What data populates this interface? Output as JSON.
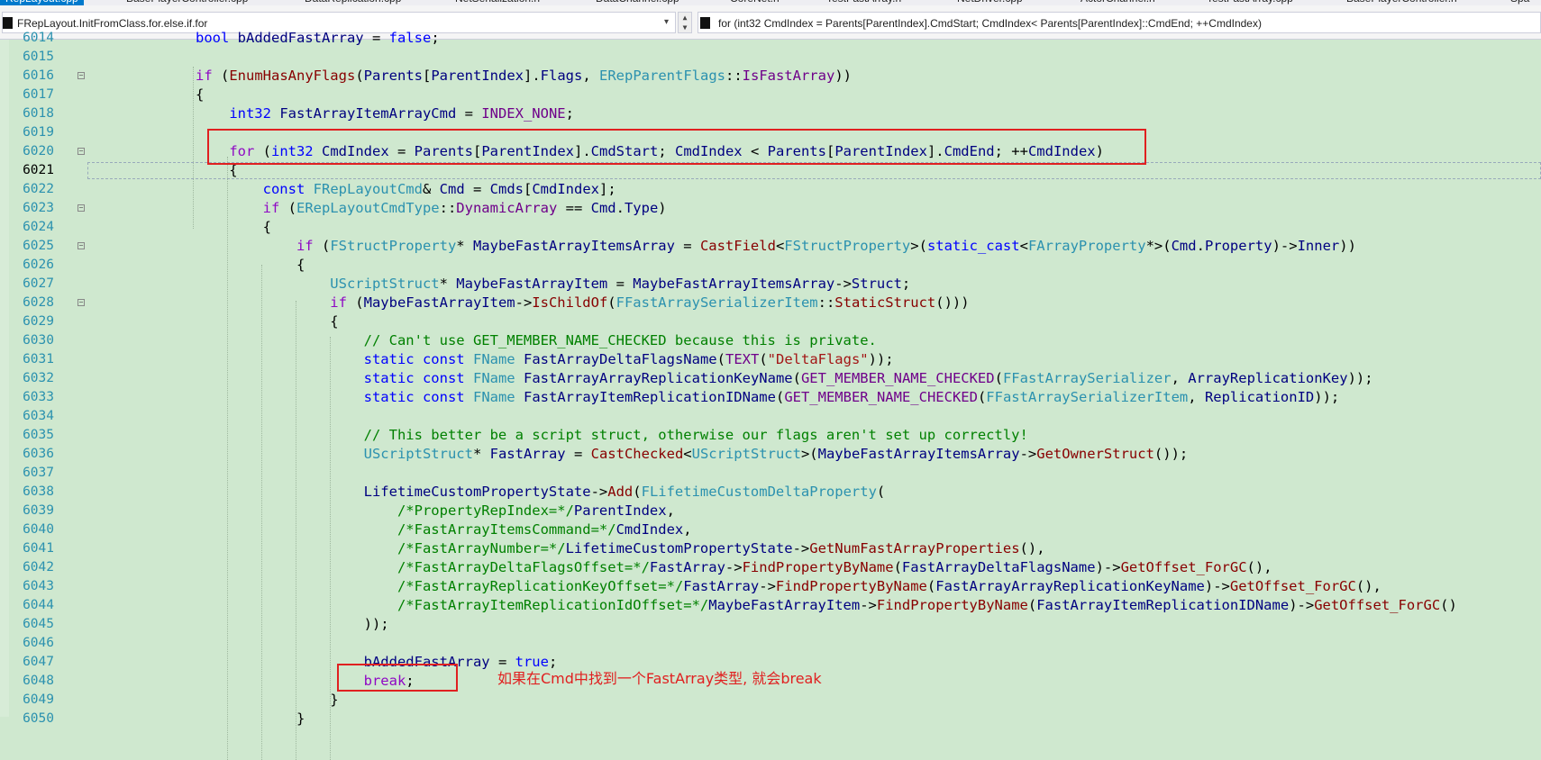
{
  "tabs": [
    {
      "label": "RepLayout.cpp",
      "active": true
    },
    {
      "label": "BasePlayerController.cpp"
    },
    {
      "label": "DataReplication.cpp"
    },
    {
      "label": "NetSerialization.h"
    },
    {
      "label": "DataChannel.cpp"
    },
    {
      "label": "CoreNet.h"
    },
    {
      "label": "TestFastArray.h"
    },
    {
      "label": "NetDriver.cpp"
    },
    {
      "label": "ActorChannel.h"
    },
    {
      "label": "TestFastArray.cpp"
    },
    {
      "label": "BasePlayerController.h"
    },
    {
      "label": "Spa"
    }
  ],
  "nav": {
    "scope": "FRepLayout.InitFromClass.for.else.if.for",
    "member": "for (int32 CmdIndex = Parents[ParentIndex].CmdStart; CmdIndex< Parents[ParentIndex]::CmdEnd; ++CmdIndex)"
  },
  "annotation": "如果在Cmd中找到一个FastArray类型, 就会break",
  "lines": [
    {
      "n": "6014",
      "html": "            <span class=\"kw\">bool</span> <span class=\"var\">bAddedFastArray</span> = <span class=\"kw\">false</span>;"
    },
    {
      "n": "6015",
      "html": ""
    },
    {
      "n": "6016",
      "fold": true,
      "html": "            <span class=\"ctrl\">if</span> (<span class=\"fcall\">EnumHasAnyFlags</span>(<span class=\"var\">Parents</span>[<span class=\"var\">ParentIndex</span>].<span class=\"mem\">Flags</span>, <span class=\"cls\">ERepParentFlags</span>::<span class=\"mac\">IsFastArray</span>))"
    },
    {
      "n": "6017",
      "html": "            {"
    },
    {
      "n": "6018",
      "html": "                <span class=\"kw\">int32</span> <span class=\"var\">FastArrayItemArrayCmd</span> = <span class=\"mac\">INDEX_NONE</span>;"
    },
    {
      "n": "6019",
      "html": ""
    },
    {
      "n": "6020",
      "fold": true,
      "html": "                <span class=\"ctrl\">for</span> (<span class=\"kw\">int32</span> <span class=\"var\">CmdIndex</span> = <span class=\"var\">Parents</span>[<span class=\"var\">ParentIndex</span>].<span class=\"mem\">CmdStart</span>; <span class=\"var\">CmdIndex</span> &lt; <span class=\"var\">Parents</span>[<span class=\"var\">ParentIndex</span>].<span class=\"mem\">CmdEnd</span>; ++<span class=\"var\">CmdIndex</span>)"
    },
    {
      "n": "6021",
      "cur": true,
      "html": "                {"
    },
    {
      "n": "6022",
      "html": "                    <span class=\"kw\">const</span> <span class=\"cls\">FRepLayoutCmd</span>&amp; <span class=\"var\">Cmd</span> = <span class=\"var\">Cmds</span>[<span class=\"var\">CmdIndex</span>];"
    },
    {
      "n": "6023",
      "fold": true,
      "html": "                    <span class=\"ctrl\">if</span> (<span class=\"cls\">ERepLayoutCmdType</span>::<span class=\"mac\">DynamicArray</span> == <span class=\"var\">Cmd</span>.<span class=\"mem\">Type</span>)"
    },
    {
      "n": "6024",
      "html": "                    {"
    },
    {
      "n": "6025",
      "fold": true,
      "html": "                        <span class=\"ctrl\">if</span> (<span class=\"cls\">FStructProperty</span>* <span class=\"var\">MaybeFastArrayItemsArray</span> = <span class=\"fcall\">CastField</span>&lt;<span class=\"cls\">FStructProperty</span>&gt;(<span class=\"kw\">static_cast</span>&lt;<span class=\"cls\">FArrayProperty</span>*&gt;(<span class=\"var\">Cmd</span>.<span class=\"mem\">Property</span>)-&gt;<span class=\"mem\">Inner</span>))"
    },
    {
      "n": "6026",
      "html": "                        {"
    },
    {
      "n": "6027",
      "html": "                            <span class=\"cls\">UScriptStruct</span>* <span class=\"var\">MaybeFastArrayItem</span> = <span class=\"var\">MaybeFastArrayItemsArray</span>-&gt;<span class=\"mem\">Struct</span>;"
    },
    {
      "n": "6028",
      "fold": true,
      "html": "                            <span class=\"ctrl\">if</span> (<span class=\"var\">MaybeFastArrayItem</span>-&gt;<span class=\"fcall\">IsChildOf</span>(<span class=\"cls\">FFastArraySerializerItem</span>::<span class=\"fcall\">StaticStruct</span>()))"
    },
    {
      "n": "6029",
      "html": "                            {"
    },
    {
      "n": "6030",
      "html": "                                <span class=\"com\">// Can't use GET_MEMBER_NAME_CHECKED because this is private.</span>"
    },
    {
      "n": "6031",
      "html": "                                <span class=\"kw\">static</span> <span class=\"kw\">const</span> <span class=\"cls\">FName</span> <span class=\"var\">FastArrayDeltaFlagsName</span>(<span class=\"mac\">TEXT</span>(<span class=\"str\">\"DeltaFlags\"</span>));"
    },
    {
      "n": "6032",
      "html": "                                <span class=\"kw\">static</span> <span class=\"kw\">const</span> <span class=\"cls\">FName</span> <span class=\"var\">FastArrayArrayReplicationKeyName</span>(<span class=\"mac\">GET_MEMBER_NAME_CHECKED</span>(<span class=\"cls\">FFastArraySerializer</span>, <span class=\"var\">ArrayReplicationKey</span>));"
    },
    {
      "n": "6033",
      "html": "                                <span class=\"kw\">static</span> <span class=\"kw\">const</span> <span class=\"cls\">FName</span> <span class=\"var\">FastArrayItemReplicationIDName</span>(<span class=\"mac\">GET_MEMBER_NAME_CHECKED</span>(<span class=\"cls\">FFastArraySerializerItem</span>, <span class=\"var\">ReplicationID</span>));"
    },
    {
      "n": "6034",
      "html": ""
    },
    {
      "n": "6035",
      "html": "                                <span class=\"com\">// This better be a script struct, otherwise our flags aren't set up correctly!</span>"
    },
    {
      "n": "6036",
      "html": "                                <span class=\"cls\">UScriptStruct</span>* <span class=\"var\">FastArray</span> = <span class=\"fcall\">CastChecked</span>&lt;<span class=\"cls\">UScriptStruct</span>&gt;(<span class=\"var\">MaybeFastArrayItemsArray</span>-&gt;<span class=\"fcall\">GetOwnerStruct</span>());"
    },
    {
      "n": "6037",
      "html": ""
    },
    {
      "n": "6038",
      "html": "                                <span class=\"var\">LifetimeCustomPropertyState</span>-&gt;<span class=\"fcall\">Add</span>(<span class=\"cls\">FLifetimeCustomDeltaProperty</span>("
    },
    {
      "n": "6039",
      "html": "                                    <span class=\"com\">/*PropertyRepIndex=*/</span><span class=\"var\">ParentIndex</span>,"
    },
    {
      "n": "6040",
      "html": "                                    <span class=\"com\">/*FastArrayItemsCommand=*/</span><span class=\"var\">CmdIndex</span>,"
    },
    {
      "n": "6041",
      "html": "                                    <span class=\"com\">/*FastArrayNumber=*/</span><span class=\"var\">LifetimeCustomPropertyState</span>-&gt;<span class=\"fcall\">GetNumFastArrayProperties</span>(),"
    },
    {
      "n": "6042",
      "html": "                                    <span class=\"com\">/*FastArrayDeltaFlagsOffset=*/</span><span class=\"var\">FastArray</span>-&gt;<span class=\"fcall\">FindPropertyByName</span>(<span class=\"var\">FastArrayDeltaFlagsName</span>)-&gt;<span class=\"fcall\">GetOffset_ForGC</span>(),"
    },
    {
      "n": "6043",
      "html": "                                    <span class=\"com\">/*FastArrayReplicationKeyOffset=*/</span><span class=\"var\">FastArray</span>-&gt;<span class=\"fcall\">FindPropertyByName</span>(<span class=\"var\">FastArrayArrayReplicationKeyName</span>)-&gt;<span class=\"fcall\">GetOffset_ForGC</span>(),"
    },
    {
      "n": "6044",
      "html": "                                    <span class=\"com\">/*FastArrayItemReplicationIdOffset=*/</span><span class=\"var\">MaybeFastArrayItem</span>-&gt;<span class=\"fcall\">FindPropertyByName</span>(<span class=\"var\">FastArrayItemReplicationIDName</span>)-&gt;<span class=\"fcall\">GetOffset_ForGC</span>()"
    },
    {
      "n": "6045",
      "html": "                                ));"
    },
    {
      "n": "6046",
      "html": ""
    },
    {
      "n": "6047",
      "html": "                                <span class=\"var\">bAddedFastArray</span> = <span class=\"kw\">true</span>;"
    },
    {
      "n": "6048",
      "html": "                                <span class=\"ctrl\">break</span>;"
    },
    {
      "n": "6049",
      "html": "                            }"
    },
    {
      "n": "6050",
      "html": "                        }"
    }
  ]
}
